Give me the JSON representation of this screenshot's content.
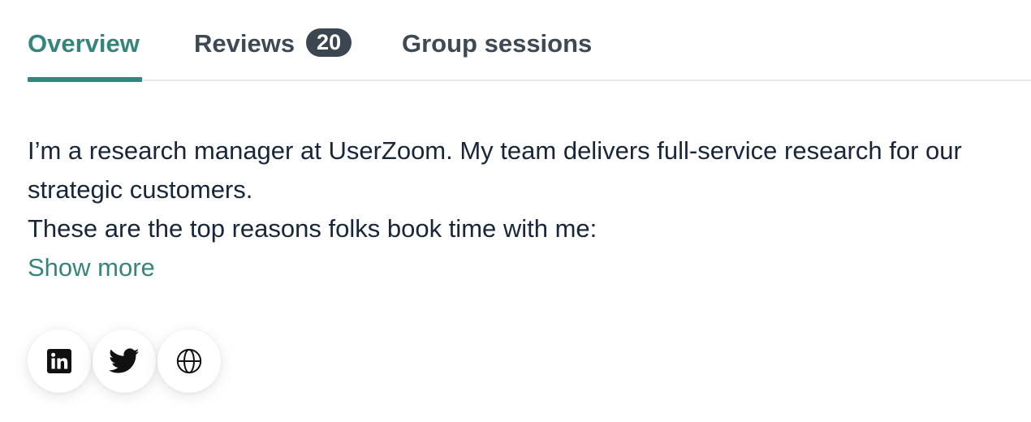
{
  "tabs": [
    {
      "label": "Overview",
      "active": true
    },
    {
      "label": "Reviews",
      "badge": "20",
      "active": false
    },
    {
      "label": "Group sessions",
      "active": false
    }
  ],
  "bio": {
    "paragraph1": "I’m a research manager at UserZoom. My team delivers full-service research for our strategic customers.",
    "paragraph2": "These are the top reasons folks book time with me:"
  },
  "show_more_label": "Show more",
  "social": [
    {
      "icon": "linkedin-icon"
    },
    {
      "icon": "twitter-icon"
    },
    {
      "icon": "globe-icon"
    }
  ],
  "colors": {
    "accent": "#35857e",
    "text": "#17263a",
    "tab_text": "#3d4a55",
    "badge_bg": "#3b4650"
  }
}
